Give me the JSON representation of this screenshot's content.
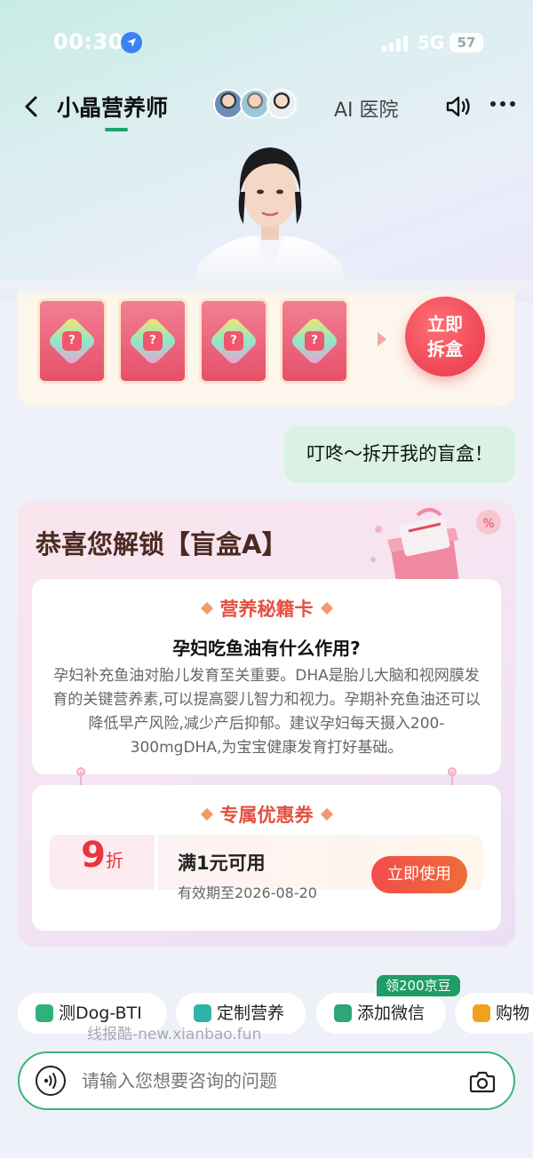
{
  "status_bar": {
    "time": "00:30",
    "network": "5G",
    "battery": "57"
  },
  "nav": {
    "title": "小晶营养师",
    "ai_hospital": "AI 医院"
  },
  "blind_box": {
    "tickets": [
      "?",
      "?",
      "?",
      "?"
    ],
    "open_button": [
      "立即",
      "拆盒"
    ]
  },
  "user_message": "叮咚～拆开我的盲盒！",
  "result_card": {
    "title": "恭喜您解锁【盲盒A】",
    "tip_section": {
      "heading": "营养秘籍卡",
      "question": "孕妇吃鱼油有什么作用?",
      "answer": "孕妇补充鱼油对胎儿发育至关重要。DHA是胎儿大脑和视网膜发育的关键营养素,可以提高婴儿智力和视力。孕期补充鱼油还可以降低早产风险,减少产后抑郁。建议孕妇每天摄入200-300mgDHA,为宝宝健康发育打好基础。"
    },
    "coupon_section": {
      "heading": "专属优惠券",
      "discount": "9",
      "unit": "折",
      "condition": "满1元可用",
      "expiry": "有效期至2026-08-20",
      "use_button": "立即使用"
    }
  },
  "quick_actions": [
    {
      "label": "测Dog-BTI",
      "icon": "chat-icon",
      "color": "#2fb27a"
    },
    {
      "label": "定制营养",
      "icon": "bag-icon",
      "color": "#2fb4a8"
    },
    {
      "label": "添加微信",
      "icon": "crown-icon",
      "color": "#2fa67a"
    },
    {
      "label": "购物",
      "icon": "cart-icon",
      "color": "#f2a11e"
    }
  ],
  "wechat_badge": "领200京豆",
  "watermark": "线报酷-new.xianbao.fun",
  "input": {
    "placeholder": "请输入您想要咨询的问题"
  },
  "colors": {
    "accent_green": "#1aa36a",
    "coupon_red": "#e8353f",
    "bubble_green": "#d9f2e4"
  }
}
